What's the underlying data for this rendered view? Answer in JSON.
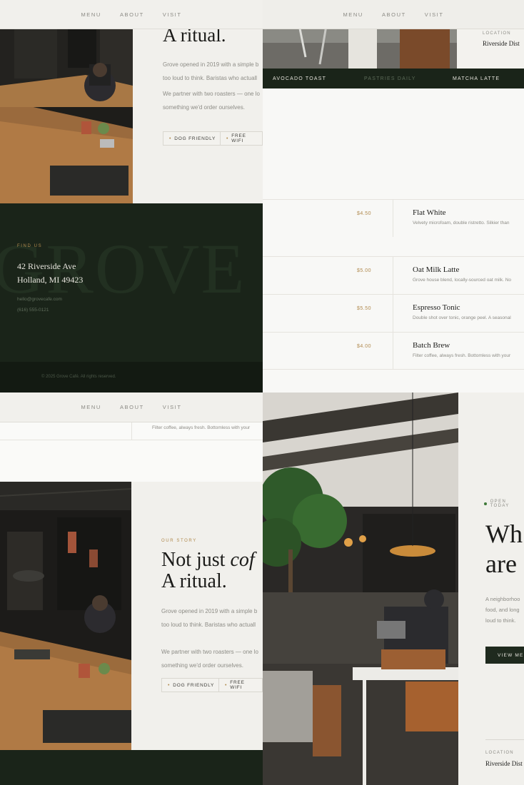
{
  "nav": {
    "menu": "MENU",
    "about": "ABOUT",
    "visit": "VISIT"
  },
  "story": {
    "eyebrow": "OUR STORY",
    "heading_line1": "Not just ",
    "heading_italic": "cof",
    "heading_line2": "A ritual.",
    "p1_l1": "Grove opened in 2019 with a simple b",
    "p1_l2": "too loud to think. Baristas who actuall",
    "p2_l1": "We partner with two roasters — one lo",
    "p2_l2": "something we'd order ourselves.",
    "tag1": "DOG FRIENDLY",
    "tag2": "FREE WIFI",
    "top_p1_l1": "Grove opened in 2019 with a simple b",
    "top_p1_l2": "too loud to think. Baristas who actuall"
  },
  "location": {
    "label": "LOCATION",
    "value": "Riverside Dist"
  },
  "menu_tabs": [
    "AVOCADO TOAST",
    "PASTRIES DAILY",
    "MATCHA LATTE"
  ],
  "menu_items": [
    {
      "price": "$4.50",
      "name": "Flat White",
      "desc": "Velvety microfoam, double ristretto. Silkier than"
    },
    {
      "price": "$5.00",
      "name": "Oat Milk Latte",
      "desc": "Grove house blend, locally-sourced oat milk. No"
    },
    {
      "price": "$5.50",
      "name": "Espresso Tonic",
      "desc": "Double shot over tonic, orange peel. A seasonal"
    },
    {
      "price": "$4.00",
      "name": "Batch Brew",
      "desc": "Filter coffee, always fresh. Bottomless with your"
    }
  ],
  "footer": {
    "eyebrow": "FIND US",
    "addr1": "42 Riverside Ave",
    "addr2": "Holland, MI 49423",
    "email": "hello@grovecafe.com",
    "phone": "(616) 555-0121",
    "watermark": "GROVE",
    "copyright": "© 2025 Grove Café. All rights reserved."
  },
  "partial_row": "Filter coffee, always fresh. Bottomless with your",
  "hero": {
    "badge": "OPEN TODAY",
    "heading_l1": "Wh",
    "heading_l2": "are",
    "p_l1": "A neighborhoo",
    "p_l2": "food, and long",
    "p_l3": "loud to think.",
    "cta": "VIEW ME"
  },
  "colors": {
    "forest": "#1a2419",
    "accent": "#b08a4e",
    "paper": "#f4f3ef"
  }
}
